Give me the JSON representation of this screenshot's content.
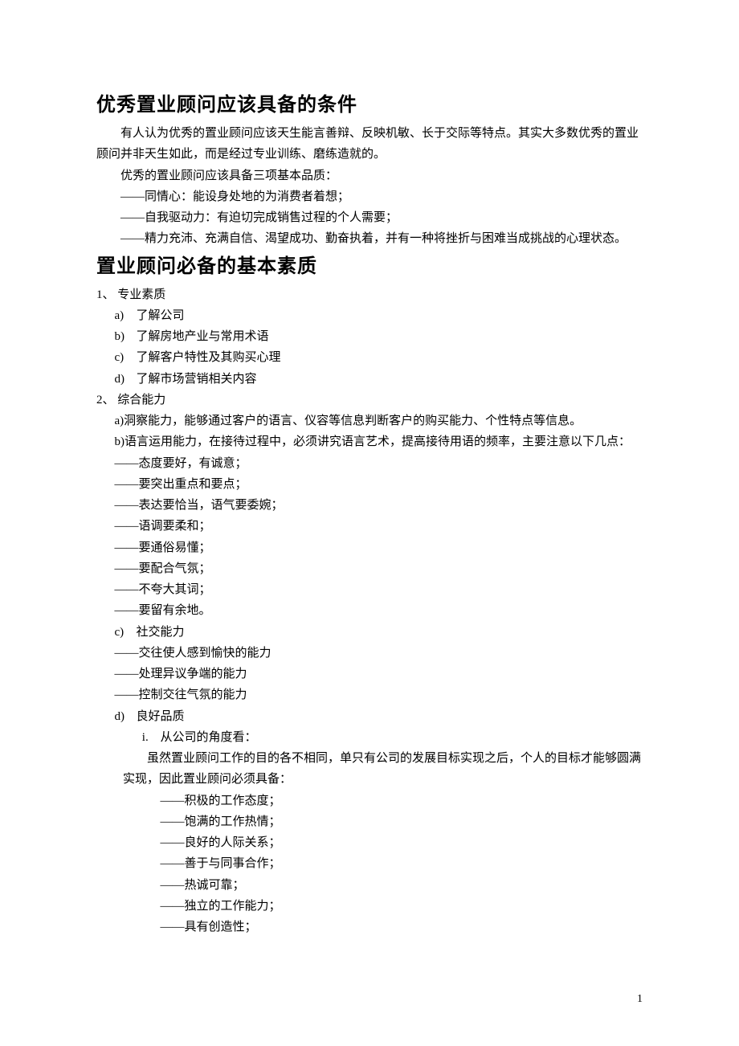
{
  "heading1": "优秀置业顾问应该具备的条件",
  "p1": "有人认为优秀的置业顾问应该天生能言善辩、反映机敏、长于交际等特点。其实大多数优秀的置业顾问并非天生如此，而是经过专业训练、磨练造就的。",
  "p2": "优秀的置业顾问应该具备三项基本品质：",
  "p3": "——同情心：能设身处地的为消费者着想；",
  "p4": "——自我驱动力：有迫切完成销售过程的个人需要；",
  "p5": "——精力充沛、充满自信、渴望成功、勤奋执着，并有一种将挫折与困难当成挑战的心理状态。",
  "heading2": "置业顾问必备的基本素质",
  "s1_num": "1、 专业素质",
  "s1_a": "了解公司",
  "s1_b": "了解房地产业与常用术语",
  "s1_c": "了解客户特性及其购买心理",
  "s1_d": "了解市场营销相关内容",
  "s2_num": "2、 综合能力",
  "s2_a": "洞察能力，能够通过客户的语言、仪容等信息判断客户的购买能力、个性特点等信息。",
  "s2_b": "语言运用能力，在接待过程中，必须讲究语言艺术，提高接待用语的频率，主要注意以下几点：",
  "d1": "——态度要好，有诚意；",
  "d2": "——要突出重点和要点；",
  "d3": "——表达要恰当，语气要委婉；",
  "d4": "——语调要柔和；",
  "d5": "——要通俗易懂；",
  "d6": "——要配合气氛；",
  "d7": "——不夸大其词；",
  "d8": "——要留有余地。",
  "s2_c": "社交能力",
  "dc1": "——交往使人感到愉快的能力",
  "dc2": "——处理异议争端的能力",
  "dc3": "——控制交往气氛的能力",
  "s2_d": "良好品质",
  "i_lbl": "i.",
  "i_txt": "从公司的角度看：",
  "i_para": "虽然置业顾问工作的目的各不相同，单只有公司的发展目标实现之后，个人的目标才能够圆满实现，因此置业顾问必须具备：",
  "dd1": "——积极的工作态度；",
  "dd2": "——饱满的工作热情；",
  "dd3": "——良好的人际关系；",
  "dd4": "——善于与同事合作；",
  "dd5": "——热诚可靠；",
  "dd6": "——独立的工作能力；",
  "dd7": "——具有创造性；",
  "lbl_a": "a)",
  "lbl_b": "b)",
  "lbl_c": "c)",
  "lbl_d": "d)",
  "page_number": "1"
}
